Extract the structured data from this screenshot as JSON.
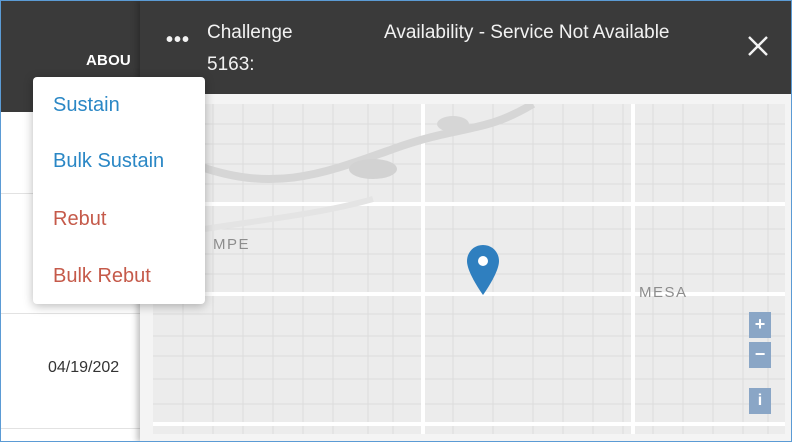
{
  "background_table": {
    "column_header": "ABOU",
    "row_date": "04/19/202"
  },
  "modal": {
    "more_label": "•••",
    "title_left": "Challenge 5163:",
    "title_right": "Availability - Service Not Available",
    "close_label": "✕"
  },
  "menu": {
    "items": [
      {
        "label": "Sustain",
        "kind": "sustain"
      },
      {
        "label": "Bulk Sustain",
        "kind": "sustain"
      },
      {
        "label": "Rebut",
        "kind": "rebut"
      },
      {
        "label": "Bulk Rebut",
        "kind": "rebut"
      }
    ]
  },
  "map": {
    "labels": {
      "tempe": "MPE",
      "mesa": "MESA"
    },
    "controls": {
      "zoom_in": "+",
      "zoom_out": "−",
      "info": "i"
    }
  },
  "colors": {
    "header_bg": "#3a3a3a",
    "sustain": "#2a87c5",
    "rebut": "#c55a4a",
    "pin": "#2f7fbf",
    "map_control": "#8aa6c6"
  },
  "icons": {
    "more": "more-horizontal-icon",
    "close": "close-icon",
    "pin": "map-pin-icon"
  }
}
